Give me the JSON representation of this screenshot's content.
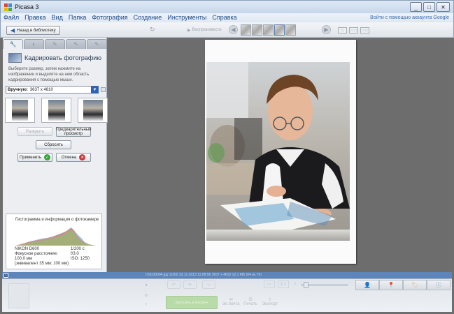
{
  "window": {
    "title": "Picasa 3",
    "controls": [
      "_",
      "□",
      "✕"
    ]
  },
  "menu": {
    "items": [
      "Файл",
      "Правка",
      "Вид",
      "Папка",
      "Фотография",
      "Создание",
      "Инструменты",
      "Справка"
    ],
    "signin": "Войти с помощью аккаунта Google"
  },
  "toolbar": {
    "back_label": "Назад в библиотеку",
    "play_label": "Воспроизвести"
  },
  "left_panel": {
    "tabs": [
      "wrench-icon",
      "tune-icon",
      "brush-icon",
      "palette-icon",
      "effects-icon"
    ],
    "crop_title": "Кадрировать фотографию",
    "crop_desc": "Выберите размер, затем нажмите на изображение и выделите на нем область кадрирования с помощью мыши.",
    "ratio_label": "Вручную:",
    "ratio_value": "3637 x 4810",
    "buttons": {
      "reset_crop": "Разкрыть",
      "preview": "Предварительный просмотр",
      "reset": "Сбросить",
      "apply": "Применить",
      "cancel": "Отмена"
    }
  },
  "histogram": {
    "title": "Гистограмма и информация о фотокамере",
    "camera": "NIKON D600",
    "focal_label": "Фокусное расстояние:",
    "focal_value": "100.0 мм",
    "equiv": "(эквивалент 35 мм: 100 мм)",
    "shutter": "1/200 с",
    "aperture": "f/3.0",
    "iso": "ISO: 1250"
  },
  "status": {
    "text": "DSC00004.jpg    1/200    23.12.2013 11:08:56    3637 x 4810    12,1 МБ    (64 из 70)"
  },
  "tray": {
    "share_label": "Загрузить в Google+",
    "email_label": "Эл.почта",
    "print_label": "Печать",
    "export_label": "Экспорт"
  },
  "colors": {
    "accent": "#2e63b6",
    "status_bar": "#5d85b9",
    "preview_bg": "#6d6d6d"
  }
}
